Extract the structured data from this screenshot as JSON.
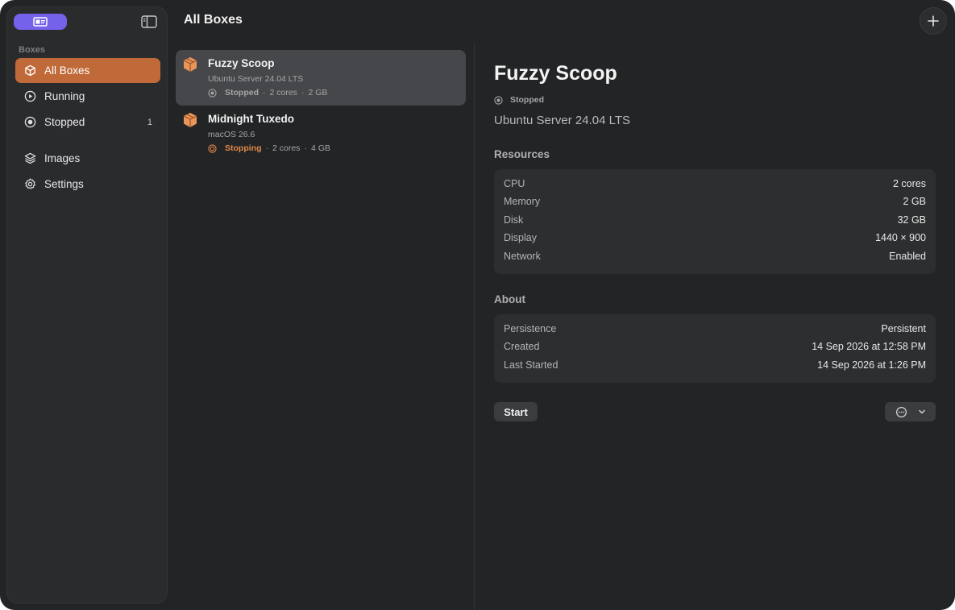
{
  "sidebar": {
    "section_label": "Boxes",
    "items": [
      {
        "label": "All Boxes",
        "icon": "cube-icon",
        "active": true
      },
      {
        "label": "Running",
        "icon": "play-circle-icon"
      },
      {
        "label": "Stopped",
        "icon": "stop-circle-icon",
        "count": "1"
      },
      {
        "label": "Images",
        "icon": "layers-icon"
      },
      {
        "label": "Settings",
        "icon": "gear-icon"
      }
    ]
  },
  "header": {
    "title": "All Boxes",
    "add_icon": "plus-icon"
  },
  "list": {
    "items": [
      {
        "name": "Fuzzy Scoop",
        "os": "Ubuntu Server 24.04 LTS",
        "state": "Stopped",
        "cores": "2 cores",
        "memory": "2 GB",
        "sep": "·",
        "selected": true
      },
      {
        "name": "Midnight Tuxedo",
        "os": "macOS 26.6",
        "state": "Stopping",
        "cores": "2 cores",
        "memory": "4 GB",
        "sep": "·"
      }
    ]
  },
  "detail": {
    "name": "Fuzzy Scoop",
    "state": "Stopped",
    "os": "Ubuntu Server 24.04 LTS",
    "resources_title": "Resources",
    "resources": [
      {
        "key": "CPU",
        "value": "2 cores"
      },
      {
        "key": "Memory",
        "value": "2 GB"
      },
      {
        "key": "Disk",
        "value": "32 GB"
      },
      {
        "key": "Display",
        "value": "1440 × 900"
      },
      {
        "key": "Network",
        "value": "Enabled"
      }
    ],
    "about_title": "About",
    "about": [
      {
        "key": "Persistence",
        "value": "Persistent"
      },
      {
        "key": "Created",
        "value": "14 Sep 2026 at 12:58 PM"
      },
      {
        "key": "Last Started",
        "value": "14 Sep 2026 at 1:26 PM"
      }
    ],
    "start_label": "Start"
  },
  "colors": {
    "accent": "#c06a3a",
    "badge": "#7462ea",
    "stopping": "#e0874a",
    "box_icon": "#e8955a"
  }
}
